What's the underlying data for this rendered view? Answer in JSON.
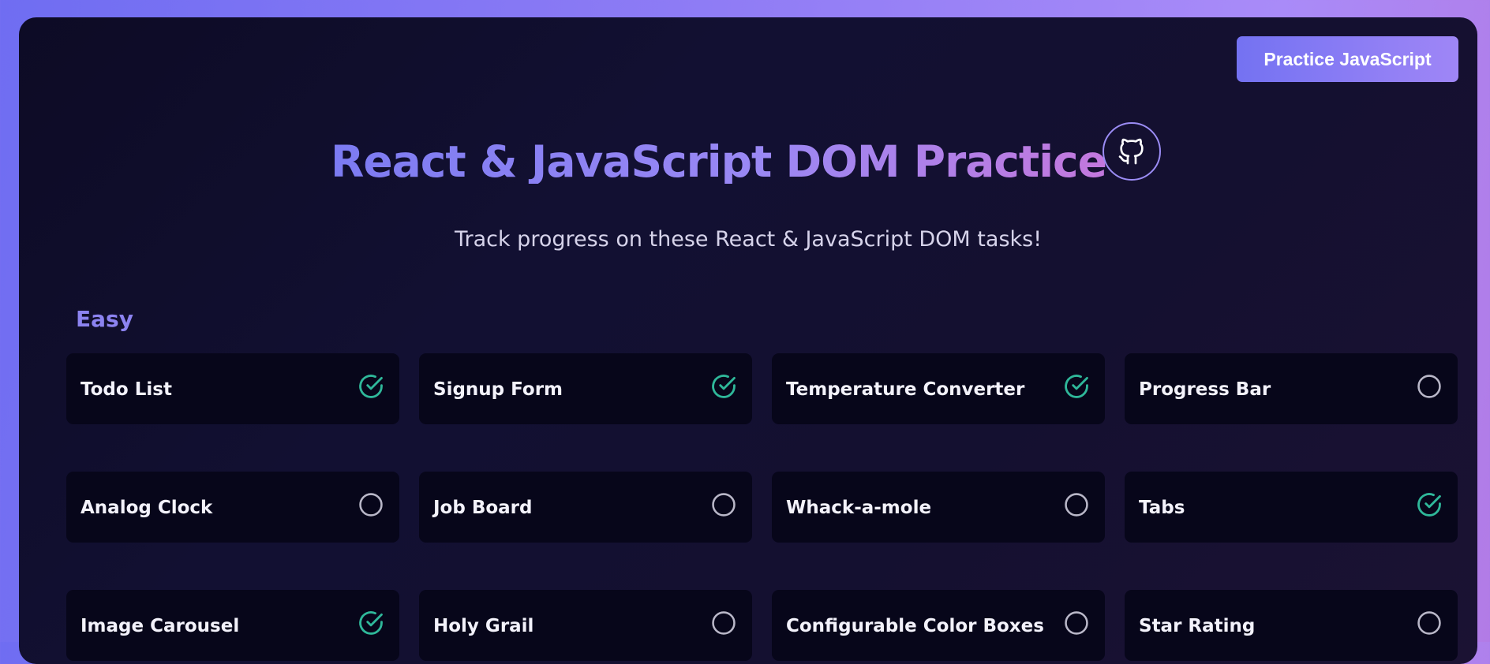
{
  "header": {
    "practice_button_label": "Practice JavaScript",
    "title": "React & JavaScript DOM Practice",
    "github_icon": "github-icon",
    "subtitle": "Track progress on these React & JavaScript DOM tasks!"
  },
  "colors": {
    "accent": "#8c83f0",
    "done": "#2fb89a",
    "todo": "#b9b7c8",
    "card_bg": "#07061a"
  },
  "sections": [
    {
      "title": "Easy",
      "tasks": [
        {
          "label": "Todo List",
          "done": true
        },
        {
          "label": "Signup Form",
          "done": true
        },
        {
          "label": "Temperature Converter",
          "done": true
        },
        {
          "label": "Progress Bar",
          "done": false
        },
        {
          "label": "Analog Clock",
          "done": false
        },
        {
          "label": "Job Board",
          "done": false
        },
        {
          "label": "Whack-a-mole",
          "done": false
        },
        {
          "label": "Tabs",
          "done": true
        },
        {
          "label": "Image Carousel",
          "done": true
        },
        {
          "label": "Holy Grail",
          "done": false
        },
        {
          "label": "Configurable Color Boxes",
          "done": false
        },
        {
          "label": "Star Rating",
          "done": false
        }
      ]
    }
  ]
}
